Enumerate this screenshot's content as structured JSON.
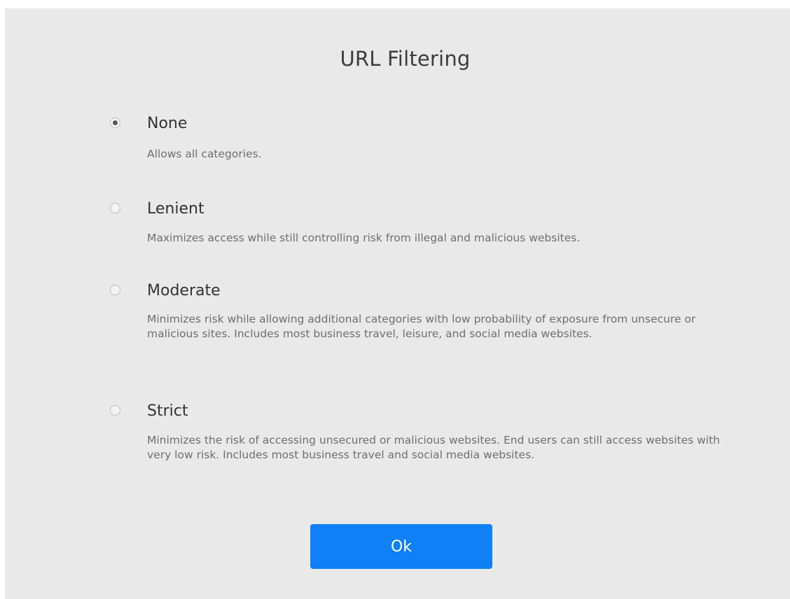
{
  "dialog": {
    "title": "URL Filtering",
    "options": [
      {
        "label": "None",
        "description": "Allows all categories.",
        "selected": true
      },
      {
        "label": "Lenient",
        "description": "Maximizes access while still controlling risk from illegal and malicious websites.",
        "selected": false
      },
      {
        "label": "Moderate",
        "description": "Minimizes risk while allowing additional categories with low probability of exposure from unsecure or malicious sites. Includes most business travel, leisure, and social media websites.",
        "selected": false
      },
      {
        "label": "Strict",
        "description": "Minimizes the risk of accessing unsecured or malicious websites. End users can still access websites with very low risk. Includes most business travel and social media websites.",
        "selected": false
      }
    ],
    "ok_label": "Ok"
  },
  "colors": {
    "background": "#e9e9e9",
    "accent": "#0f80f6"
  }
}
